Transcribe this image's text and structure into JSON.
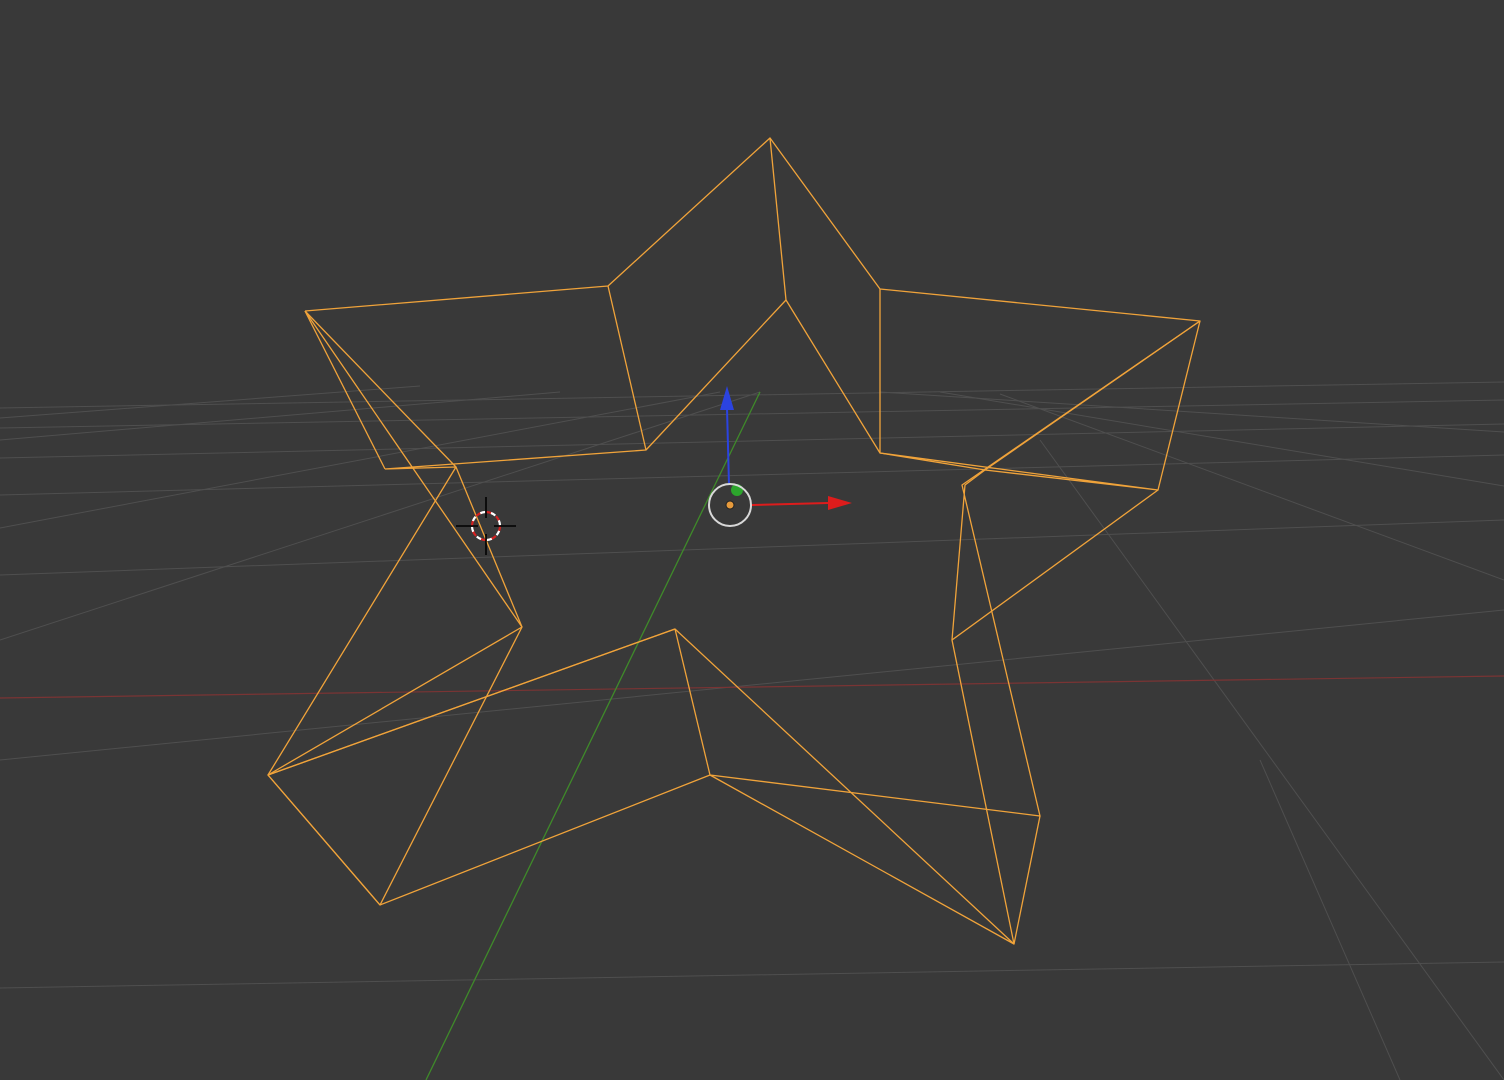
{
  "viewport": {
    "name": "3d-viewport",
    "colors": {
      "background": "#393939",
      "grid": "#4f4f4f",
      "x_axis_line": "#7a3434",
      "y_axis_line": "#3f8a2a",
      "selected_wire": "#f0a33a",
      "gizmo_x": "#dd1c1c",
      "gizmo_y": "#2ca52c",
      "gizmo_z": "#2b43e0",
      "pivot_ring": "#d8d8d8",
      "origin_dot": "#e69a3c",
      "cursor_ring_red": "#d42020",
      "cursor_ring_white": "#ffffff",
      "cursor_crosshair": "#000000"
    },
    "icons": {
      "cursor": "3d-cursor-icon",
      "origin": "object-origin-icon",
      "gizmo": "transform-gizmo-icon"
    }
  }
}
